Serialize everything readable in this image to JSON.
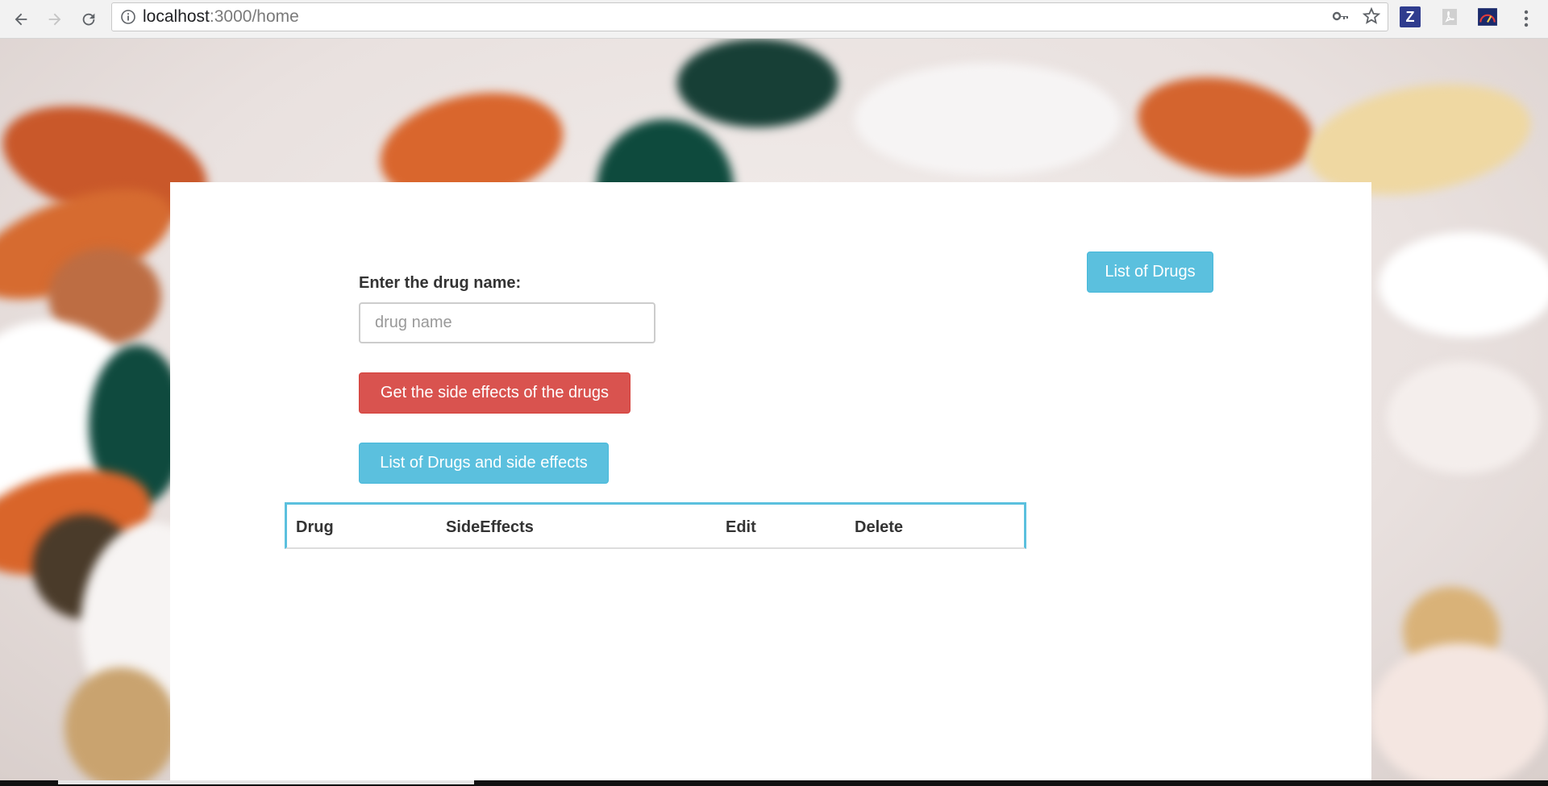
{
  "browser": {
    "url_host": "localhost",
    "url_path": ":3000/home",
    "ext_z_label": "Z"
  },
  "form": {
    "label": "Enter the drug name:",
    "input_placeholder": "drug name",
    "input_value": ""
  },
  "buttons": {
    "side_effects": "Get the side effects of the drugs",
    "list_drugs_side_effects": "List of Drugs and side effects",
    "list_drugs": "List of Drugs"
  },
  "table": {
    "columns": [
      "Drug",
      "SideEffects",
      "Edit",
      "Delete"
    ]
  },
  "colors": {
    "danger": "#d9534f",
    "info": "#5bc0de"
  }
}
